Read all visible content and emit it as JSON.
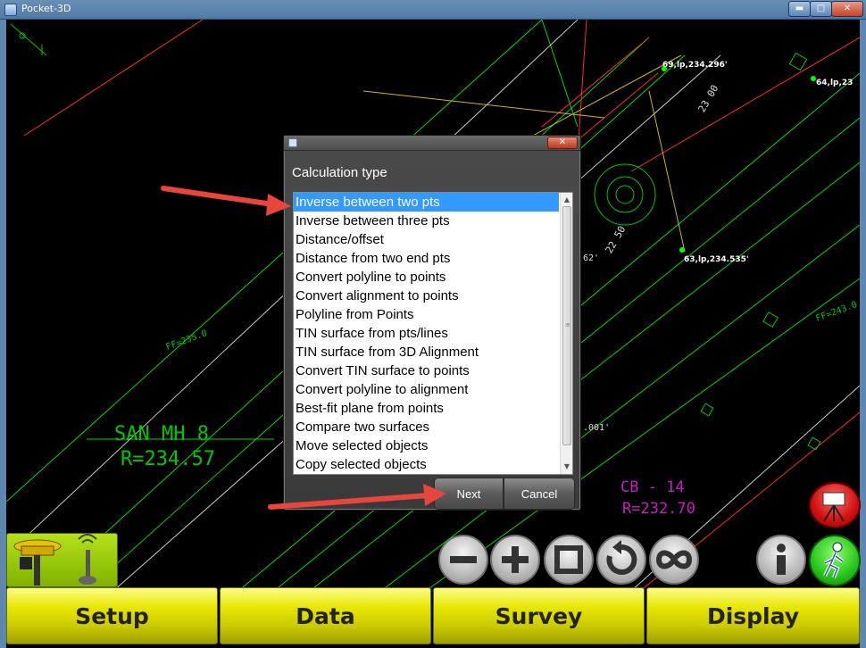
{
  "window": {
    "title": "Pocket-3D",
    "minimize_glyph": "▬",
    "maximize_glyph": "□",
    "close_glyph": "✕"
  },
  "map": {
    "labels": {
      "san_mh": "SAN MH 8",
      "san_r": "R=234.57",
      "cb": "CB - 14",
      "cb_r": "R=232.70",
      "ff_left": "FF=235.0",
      "ff_right": "FF=243.0",
      "sta_22_50": "22 50",
      "sta_23_00": "23 00",
      "dim_62": "62'",
      "dim_001": ".001'"
    },
    "points": [
      {
        "id": "69",
        "label": "69,lp,234.296'"
      },
      {
        "id": "64",
        "label": "64,lp,23"
      },
      {
        "id": "63",
        "label": "63,lp,234.535'"
      }
    ]
  },
  "dialog": {
    "close_glyph": "✕",
    "heading": "Calculation type",
    "selected_index": 0,
    "items": [
      "Inverse between two pts",
      "Inverse between three pts",
      "Distance/offset",
      "Distance from two end pts",
      "Convert polyline to points",
      "Convert alignment to points",
      "Polyline from Points",
      "TIN surface from pts/lines",
      "TIN surface from 3D Alignment",
      "Convert TIN surface to points",
      "Convert polyline to alignment",
      "Best-fit plane from points",
      "Compare two surfaces",
      "Move selected objects",
      "Copy selected objects"
    ],
    "next_label": "Next",
    "cancel_label": "Cancel"
  },
  "toolbar": {
    "zoom_out_icon": "minus-icon",
    "zoom_in_icon": "plus-icon",
    "zoom_extents_icon": "square-icon",
    "refresh_icon": "rotate-icon",
    "infinity_icon": "infinity-icon",
    "info_label": "i"
  },
  "menu": {
    "setup": "Setup",
    "data": "Data",
    "survey": "Survey",
    "display": "Display"
  },
  "colors": {
    "menu_yellow": "#e6e600",
    "selected_blue": "#3399ff",
    "cad_green": "#00ff00",
    "cad_red": "#ff2a2a",
    "arrow_red": "#e8453c"
  }
}
